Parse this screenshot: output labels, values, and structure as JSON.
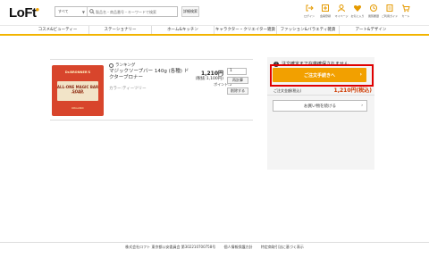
{
  "header": {
    "logo": "LoFt",
    "search": {
      "category": "すべて",
      "placeholder": "製品名・商品番号・キーワードで検索"
    },
    "advanced_search_label": "詳細検索",
    "icons": [
      {
        "name": "login-icon",
        "label": "ログイン"
      },
      {
        "name": "register-icon",
        "label": "会員登録"
      },
      {
        "name": "mypage-icon",
        "label": "マイページ"
      },
      {
        "name": "favorite-icon",
        "label": "お気に入り"
      },
      {
        "name": "history-icon",
        "label": "閲覧履歴"
      },
      {
        "name": "order-history-icon",
        "label": "ご利用ガイド"
      },
      {
        "name": "cart-icon",
        "label": "カート",
        "badge": "1"
      }
    ]
  },
  "nav": {
    "items": [
      "コスメ&ビューティー",
      "ステーショナリー",
      "ホーム&キッチン",
      "キャラクター・クリエイター雑貨",
      "ファッション&バラエティ雑貨",
      "アート&デザイン"
    ]
  },
  "cart_item": {
    "tag": "ランキング",
    "name": "マジックソープバー 140g (各種) ドクターブロナー",
    "variant": "カラー:ティーツリー",
    "price": "1,210円",
    "price_tax": "(税抜:1,100円)",
    "points": "ポイント:5",
    "quantity": "1",
    "change_label": "再計算",
    "delete_label": "削除する",
    "image": {
      "brand": "Dr.BRONNER'S",
      "title": "ALL-ONE MAGIC BAR SOAP",
      "subtitle": "TEA TREE",
      "footer": "ORGANIC"
    }
  },
  "summary": {
    "notice": "注文確定まで在庫確保されません",
    "checkout_label": "ご注文手続きへ",
    "total_label": "ご注文金額(税込)",
    "total_value": "1,210円(税込)",
    "wishlist_label": "お買い物を続ける"
  },
  "footer": {
    "company": "株式会社ロフト 東京都公安委員会 第302210700758号",
    "privacy": "個人情報保護方針",
    "specified": "特定商取引法に基づく表示"
  },
  "colors": {
    "accent": "#f2a000",
    "nav_line": "#f2b400",
    "highlight": "#e00000",
    "price": "#d03a00"
  }
}
